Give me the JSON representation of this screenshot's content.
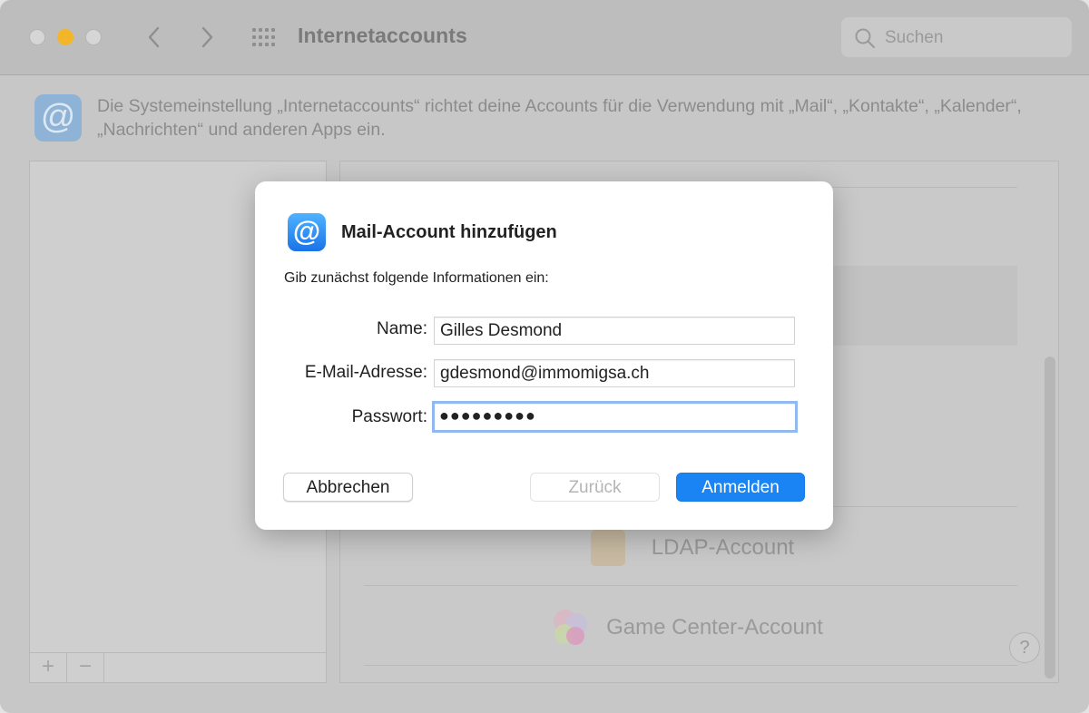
{
  "window": {
    "title": "Internetaccounts",
    "search_placeholder": "Suchen"
  },
  "description": {
    "text": "Die Systemeinstellung „Internetaccounts“ richtet deine Accounts für die Verwendung mit „Mail“, „Kontakte“, „Kalender“, „Nachrichten“ und anderen Apps ein.",
    "icon": "@"
  },
  "left_panel": {
    "add_label": "+",
    "remove_label": "−"
  },
  "right_panel": {
    "providers": [
      "LDAP-Account",
      "Game Center-Account"
    ],
    "help_label": "?"
  },
  "dialog": {
    "icon": "@",
    "title": "Mail-Account hinzufügen",
    "subtitle": "Gib zunächst folgende Informationen ein:",
    "fields": {
      "name": {
        "label": "Name:",
        "value": "Gilles Desmond"
      },
      "email": {
        "label": "E-Mail-Adresse:",
        "value": "gdesmond@immomigsa.ch"
      },
      "password": {
        "label": "Passwort:",
        "value": "●●●●●●●●●"
      }
    },
    "buttons": {
      "cancel": "Abbrechen",
      "back": "Zurück",
      "signin": "Anmelden"
    }
  },
  "colors": {
    "accent": "#1a84f5",
    "focus_ring": "#8fb9ef",
    "minimize": "#f3b628"
  }
}
